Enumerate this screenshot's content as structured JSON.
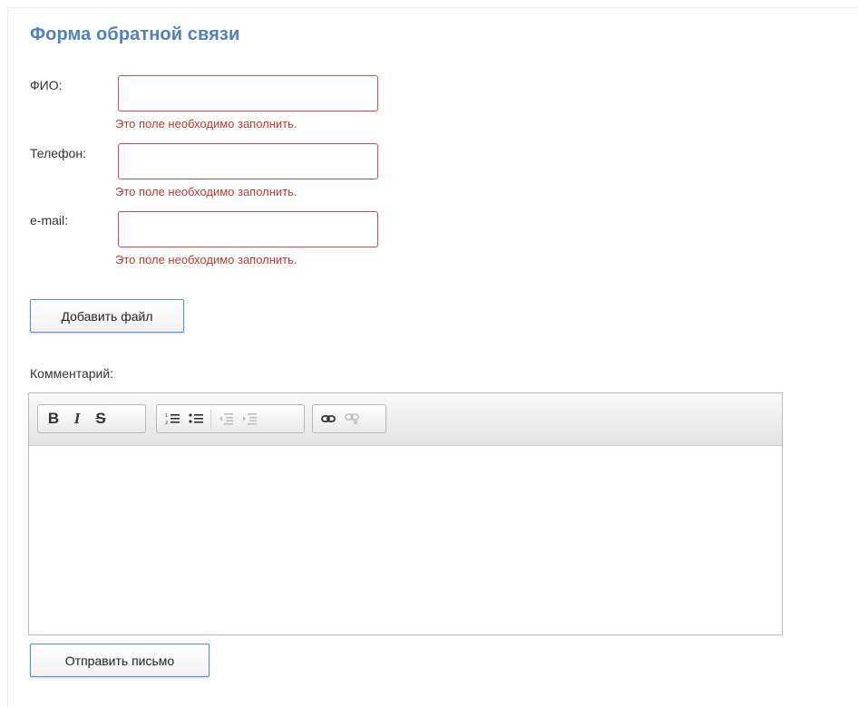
{
  "form": {
    "title": "Форма обратной связи",
    "fields": [
      {
        "label": "ФИО:",
        "value": "",
        "error": "Это поле необходимо заполнить."
      },
      {
        "label": "Телефон:",
        "value": "",
        "error": "Это поле необходимо заполнить."
      },
      {
        "label": "e-mail:",
        "value": "",
        "error": "Это поле необходимо заполнить."
      }
    ],
    "add_file_label": "Добавить файл",
    "comment_label": "Комментарий:",
    "submit_label": "Отправить письмо"
  },
  "toolbar": {
    "bold": "B",
    "italic": "I",
    "strike": "S",
    "icons": [
      "bold-icon",
      "italic-icon",
      "strikethrough-icon",
      "numbered-list-icon",
      "bulleted-list-icon",
      "decrease-indent-icon",
      "increase-indent-icon",
      "link-icon",
      "unlink-icon"
    ]
  },
  "colors": {
    "title": "#4f81bd",
    "error": "#c0392b",
    "input_border_error": "#d34b4b",
    "button_border": "#5a8fd0"
  }
}
